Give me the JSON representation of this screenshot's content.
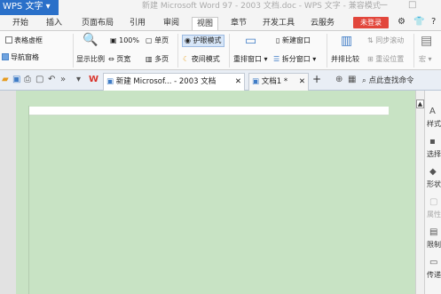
{
  "titlebar": {
    "app_name": "WPS 文字 ▾",
    "doc_title": "新建 Microsoft Word 97 - 2003 文档.doc - WPS 文字 - 兼容模式",
    "minimize": "—",
    "maximize": "□"
  },
  "menubar": {
    "items": [
      "开始",
      "插入",
      "页面布局",
      "引用",
      "审阅",
      "视图",
      "章节",
      "开发工具",
      "云服务"
    ],
    "active": "视图",
    "login_label": "未登录"
  },
  "ribbon": {
    "table_gridlines": "表格虚框",
    "nav_pane": "导航窗格",
    "display_ratio": "显示比例",
    "zoom_100": "100%",
    "single_page": "单页",
    "page_width": "页宽",
    "multi_page": "多页",
    "eye_mode": "护眼模式",
    "night_mode": "夜间模式",
    "rearrange_windows": "重排窗口 ▾",
    "split_window": "拆分窗口 ▾",
    "new_window": "新建窗口",
    "side_by_side": "并排比较",
    "sync_scroll": "同步滚动",
    "reset_position": "重设位置",
    "more": "宏 ▾"
  },
  "tabbar": {
    "active_tab": "新建 Microsof... - 2003 文档",
    "second_tab": "文档1 *",
    "search_text": "点此查找命令"
  },
  "sidepanel": {
    "items": [
      "样式",
      "选择",
      "形状",
      "属性",
      "限制",
      "传递"
    ]
  }
}
